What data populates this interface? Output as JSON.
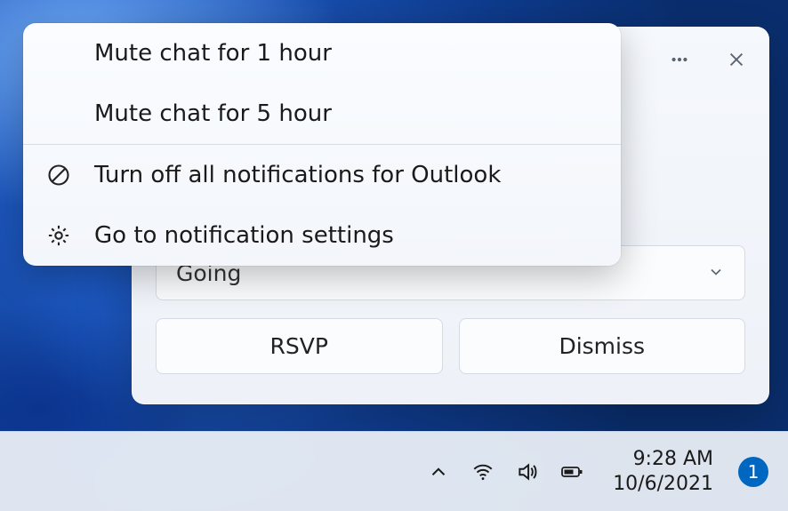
{
  "menu": {
    "mute1": "Mute chat for 1 hour",
    "mute5": "Mute chat for 5 hour",
    "turnoff": "Turn off all notifications for Outlook",
    "settings": "Go to notification settings"
  },
  "notification": {
    "select_value": "Going",
    "rsvp": "RSVP",
    "dismiss": "Dismiss"
  },
  "taskbar": {
    "time": "9:28 AM",
    "date": "10/6/2021",
    "badge": "1"
  }
}
